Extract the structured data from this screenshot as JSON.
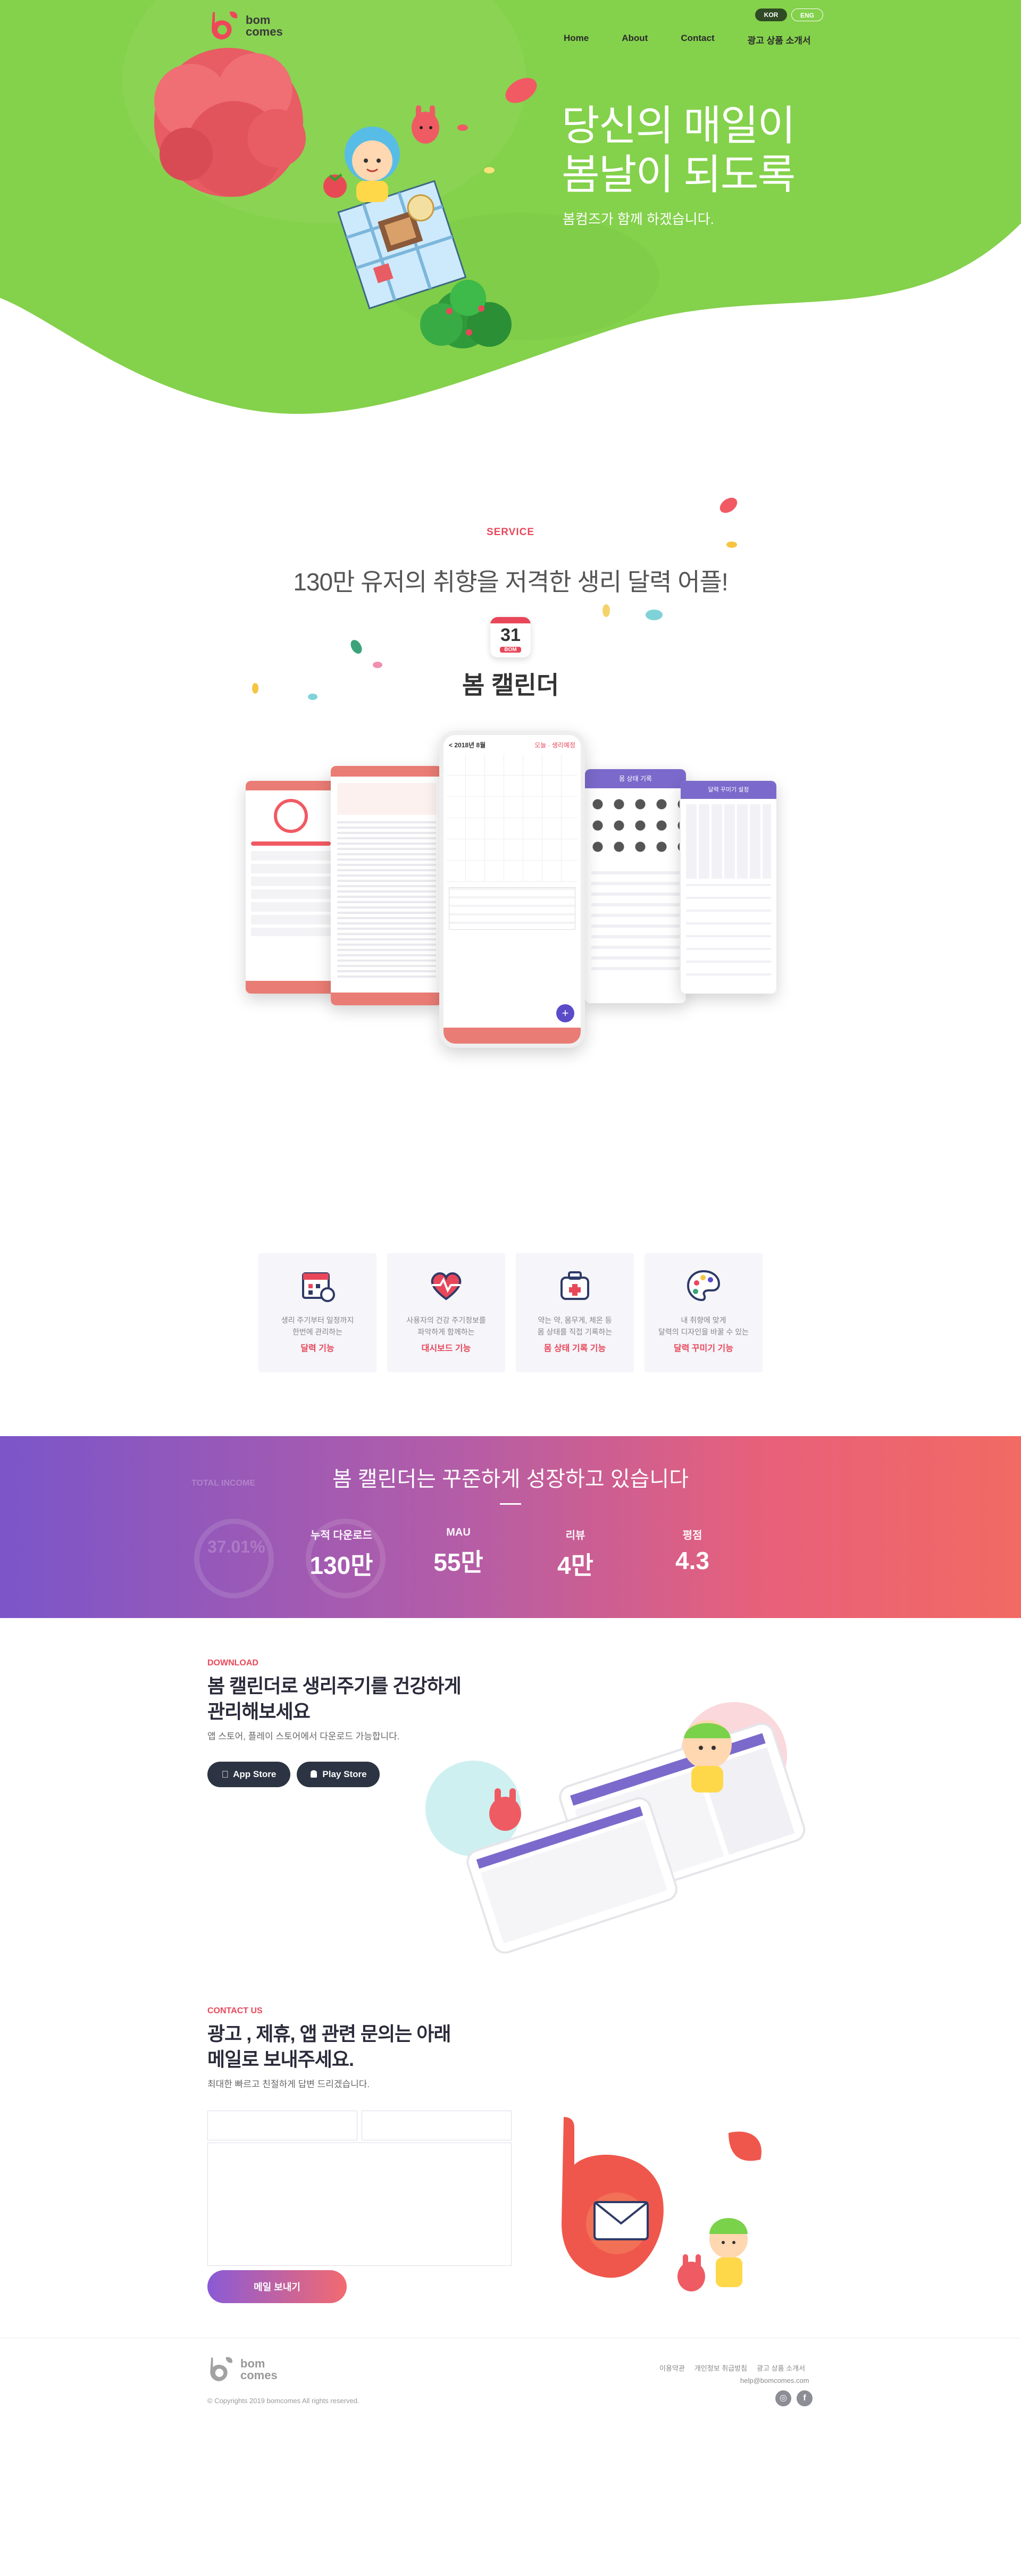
{
  "header": {
    "logo_text_top": "bom",
    "logo_text_bottom": "comes",
    "nav": [
      "Home",
      "About",
      "Contact",
      "광고 상품 소개서"
    ],
    "lang_active": "KOR",
    "lang_other": "ENG"
  },
  "hero": {
    "title_line1": "당신의 매일이",
    "title_line2": "봄날이 되도록",
    "subtitle": "봄컴즈가 함께 하겠습니다."
  },
  "service": {
    "tag": "SERVICE",
    "headline": "130만 유저의 취향을 저격한 생리 달력 어플!",
    "app_icon_number": "31",
    "app_icon_label": "BOM",
    "app_name": "봄 캘린더"
  },
  "phones": {
    "center_title": "< 2018년 8월",
    "center_badge": "오늘 · 생리예정",
    "right_title": "몸 상태 기록",
    "far_right_title": "달력 꾸미기 설정"
  },
  "features": [
    {
      "icon": "calendar-icon",
      "desc_line1": "생리 주기부터 일정까지",
      "desc_line2": "한번에 관리하는",
      "label": "달력 기능"
    },
    {
      "icon": "heart-chart-icon",
      "desc_line1": "사용자의 건강 주기정보를",
      "desc_line2": "파악하게 함께하는",
      "label": "대시보드 기능"
    },
    {
      "icon": "medical-bag-icon",
      "desc_line1": "약는 약, 몸무게, 체온 등",
      "desc_line2": "몸 상태를 직접 기록하는",
      "label": "몸 상태 기록 기능"
    },
    {
      "icon": "palette-icon",
      "desc_line1": "내 취향에 맞게",
      "desc_line2": "달력의 디자인을 바꿀 수 있는",
      "label": "달력 꾸미기 기능"
    }
  ],
  "stats": {
    "headline": "봄 캘린더는 꾸준하게 성장하고 있습니다",
    "bg_text": "TOTAL INCOME",
    "bg_percent": "37.01%",
    "items": [
      {
        "label": "누적 다운로드",
        "value": "130만"
      },
      {
        "label": "MAU",
        "value": "55만"
      },
      {
        "label": "리뷰",
        "value": "4만"
      },
      {
        "label": "평점",
        "value": "4.3"
      }
    ]
  },
  "download": {
    "tag": "DOWNLOAD",
    "title_line1": "봄 캘린더로 생리주기를 건강하게",
    "title_line2": "관리해보세요",
    "subtitle": "앱 스토어, 플레이 스토어에서 다운로드 가능합니다.",
    "app_store": "App Store",
    "play_store": "Play Store"
  },
  "contact": {
    "tag": "CONTACT US",
    "title_line1": "광고 , 제휴, 앱 관련 문의는 아래",
    "title_line2": "메일로 보내주세요.",
    "subtitle": "최대한 빠르고 친절하게 답변 드리겠습니다.",
    "name_placeholder": "",
    "email_placeholder": "",
    "message_placeholder": "",
    "send_label": "메일 보내기"
  },
  "footer": {
    "logo_text_top": "bom",
    "logo_text_bottom": "comes",
    "links": [
      "이용약관",
      "개인정보 취급방침",
      "광고 상품 소개서"
    ],
    "email": "help@bomcomes.com",
    "copyright": "© Copyrights 2019 bomcomes All rights reserved."
  },
  "colors": {
    "hero_green": "#84d14c",
    "accent_red": "#e8475a",
    "purple": "#7b55c9",
    "coral": "#f26a63"
  }
}
